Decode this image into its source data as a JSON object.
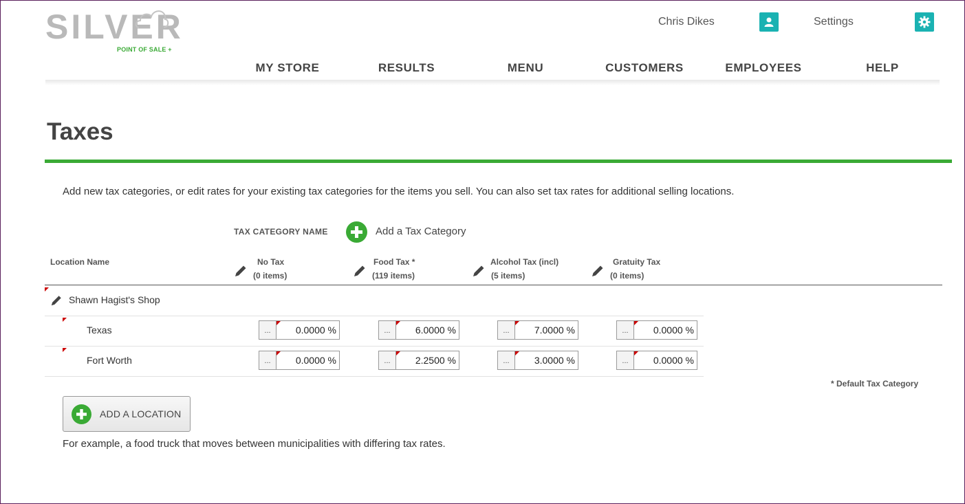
{
  "brand": {
    "name": "SILVER",
    "tagline": "POINT OF SALE +"
  },
  "header": {
    "user_name": "Chris Dikes",
    "settings_label": "Settings",
    "user_icon": "user-icon",
    "settings_icon": "gear-icon",
    "accent": "#1ab2b2"
  },
  "nav": [
    "MY STORE",
    "RESULTS",
    "MENU",
    "CUSTOMERS",
    "EMPLOYEES",
    "HELP"
  ],
  "page": {
    "title": "Taxes",
    "intro": "Add new tax categories, or edit rates for your existing tax categories for the items you sell. You can also set tax rates for additional selling locations.",
    "tax_category_label": "TAX CATEGORY NAME",
    "add_category_label": "Add a Tax Category",
    "location_header": "Location Name",
    "default_note": "* Default Tax Category",
    "add_location_label": "ADD A LOCATION",
    "example": "For example, a food truck that moves between municipalities with differing tax rates.",
    "green": "#3aaa35"
  },
  "categories": [
    {
      "name": "No Tax",
      "count": "(0 items)"
    },
    {
      "name": "Food Tax *",
      "count": "(119 items)"
    },
    {
      "name": "Alcohol Tax (incl)",
      "count": "(5 items)"
    },
    {
      "name": "Gratuity Tax",
      "count": "(0 items)"
    }
  ],
  "shop": {
    "name": "Shawn Hagist's Shop"
  },
  "locations": [
    {
      "name": "Texas",
      "rates": [
        "0.0000 %",
        "6.0000 %",
        "7.0000 %",
        "0.0000 %"
      ]
    },
    {
      "name": "Fort Worth",
      "rates": [
        "0.0000 %",
        "2.2500 %",
        "3.0000 %",
        "0.0000 %"
      ]
    }
  ],
  "rate_button_label": "..."
}
